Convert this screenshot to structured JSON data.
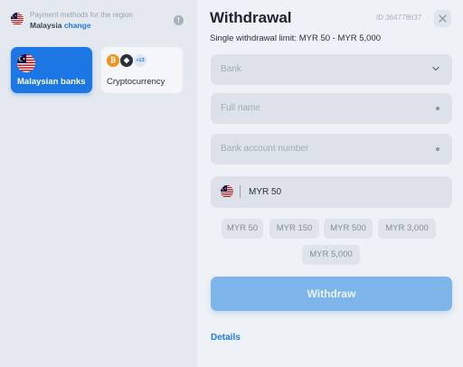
{
  "region": {
    "title": "Payment methods for the region",
    "country": "Malaysia",
    "change_label": "change",
    "info_icon": "info-icon",
    "info_glyph": "!"
  },
  "methods": [
    {
      "label": "Malaysian banks",
      "icon": "malaysia-flag-icon",
      "active": true
    },
    {
      "label": "Cryptocurrency",
      "icons": [
        "bitcoin-icon",
        "ethereum-icon"
      ],
      "more_badge": "+13",
      "active": false
    }
  ],
  "coin_glyphs": {
    "btc": "₿",
    "eth": "◆"
  },
  "withdrawal": {
    "title": "Withdrawal",
    "id_text": "ID 364778637",
    "close_icon": "close-icon",
    "limit_text": "Single withdrawal limit: MYR 50 - MYR 5,000",
    "bank_placeholder": "Bank",
    "full_name_placeholder": "Full name",
    "account_placeholder": "Bank account number",
    "amount_value": "MYR 50",
    "quick_amounts": [
      "MYR 50",
      "MYR 150",
      "MYR 500",
      "MYR 3,000",
      "MYR 5,000"
    ],
    "withdraw_label": "Withdraw",
    "details_label": "Details"
  },
  "colors": {
    "accent": "#1c76e3",
    "withdraw_button": "#7db5ea",
    "left_panel": "#e4e8ef",
    "right_panel": "#eef1f5"
  }
}
